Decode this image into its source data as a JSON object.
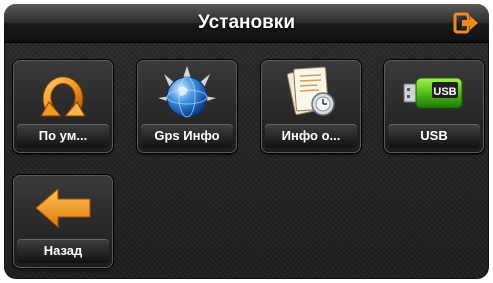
{
  "header": {
    "title": "Установки",
    "exit_icon": "exit-icon",
    "accent_color": "#f08a1c"
  },
  "tiles": [
    {
      "label": "По ум...",
      "icon": "reset-arrow-icon"
    },
    {
      "label": "Gps Инфо",
      "icon": "globe-satellite-icon"
    },
    {
      "label": "Инфо о...",
      "icon": "document-info-icon"
    },
    {
      "label": "USB",
      "icon": "usb-drive-icon"
    },
    {
      "label": "Назад",
      "icon": "back-arrow-icon"
    }
  ]
}
